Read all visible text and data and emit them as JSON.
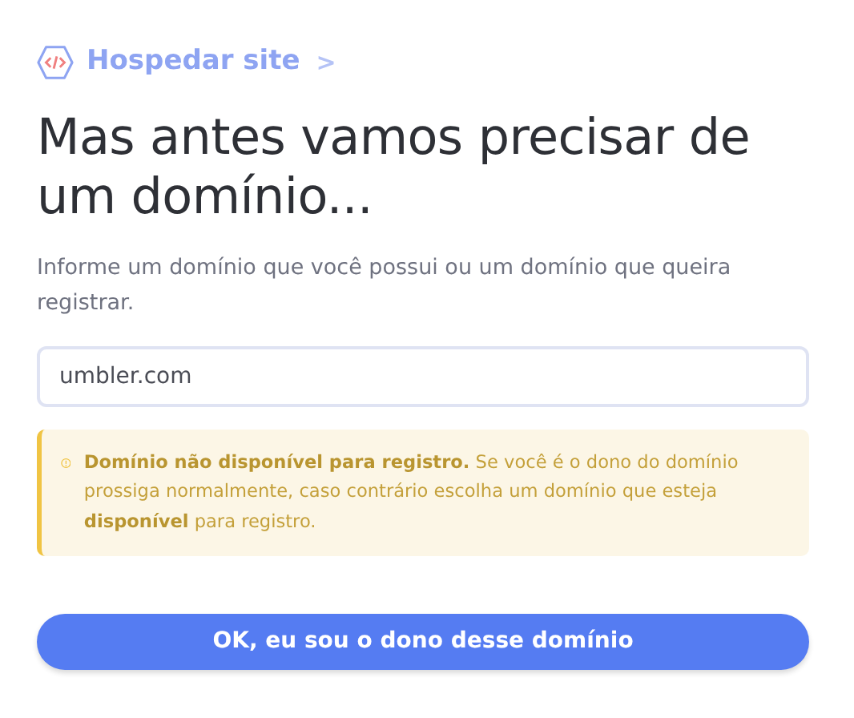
{
  "breadcrumb": {
    "label": "Hospedar site",
    "separator": ">"
  },
  "heading": "Mas antes vamos precisar de um domínio...",
  "description": "Informe um domínio que você possui ou um domínio que queira registrar.",
  "domain_field": {
    "value": "umbler.com"
  },
  "alert": {
    "kind": "warning",
    "text": "**Domínio não disponível para registro.** Se você é o dono do domínio prossiga normalmente, caso contrário escolha um domínio que esteja **disponível** para registro."
  },
  "button": {
    "label": "OK, eu sou o dono desse domínio"
  }
}
